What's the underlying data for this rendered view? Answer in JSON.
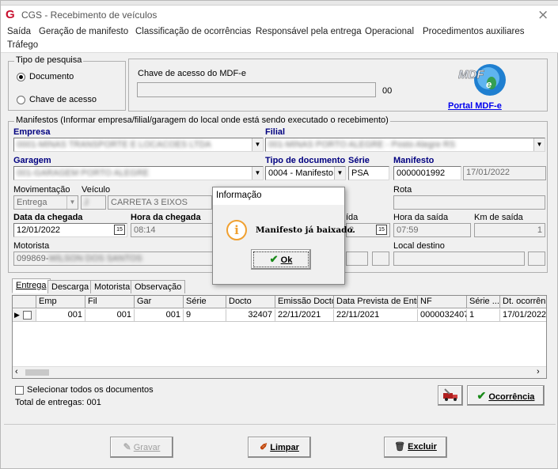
{
  "window": {
    "title": "CGS - Recebimento de veículos",
    "close_glyph": "×"
  },
  "menu": [
    "Saída",
    "Geração de manifesto",
    "Classificação de ocorrências",
    "Responsável pela entrega",
    "Operacional",
    "Procedimentos auxiliares",
    "Tráfego"
  ],
  "tipo_pesquisa": {
    "legend": "Tipo de pesquisa",
    "opt_documento": "Documento",
    "opt_chave": "Chave de acesso",
    "selected": "Documento"
  },
  "chave": {
    "label": "Chave de acesso do MDF-e",
    "value": "",
    "suffix": "00"
  },
  "portal": {
    "link": "Portal MDF-e",
    "logo_text": "MDF-e"
  },
  "manifestos": {
    "legend": "Manifestos (Informar empresa/filial/garagem do local onde está sendo executado o recebimento)",
    "empresa_label": "Empresa",
    "empresa_value": "",
    "filial_label": "Filial",
    "filial_value": "",
    "garagem_label": "Garagem",
    "garagem_value": "",
    "tipo_doc_label": "Tipo de documento",
    "tipo_doc_value": "0004 - Manifesto",
    "serie_label": "Série",
    "serie_value": "PSA",
    "manifesto_label": "Manifesto",
    "manifesto_value": "0000001992",
    "manifesto_date": "17/01/2022",
    "movimentacao_label": "Movimentação",
    "movimentacao_value": "Entrega",
    "veiculo_label": "Veículo",
    "veiculo_value": "CARRETA 3 EIXOS",
    "rota_label": "Rota",
    "data_chegada_label": "Data da chegada",
    "data_chegada_value": "12/01/2022",
    "hora_chegada_label": "Hora da chegada",
    "hora_chegada_value": "08:14",
    "data_saida_label": "ída",
    "data_saida_value": "2",
    "hora_saida_label": "Hora da saída",
    "hora_saida_value": "07:59",
    "km_saida_label": "Km de saída",
    "km_saida_value": "1",
    "motorista_label": "Motorista",
    "motorista_value": "099869-",
    "local_destino_label": "Local destino"
  },
  "tabs": [
    "Entrega",
    "Descarga",
    "Motorista",
    "Observação"
  ],
  "grid": {
    "columns": [
      "Emp",
      "Fil",
      "Gar",
      "Série",
      "Docto",
      "Emissão Docto",
      "Data Prevista de Entrega",
      "NF",
      "Série ...",
      "Dt. ocorrên"
    ],
    "rows": [
      [
        "001",
        "001",
        "001",
        "9",
        "32407",
        "22/11/2021",
        "22/11/2021",
        "0000032407",
        "1",
        "17/01/2022"
      ]
    ]
  },
  "selecionar_todos": "Selecionar todos os documentos",
  "total_entregas": "Total de entregas: 001",
  "buttons": {
    "ocorrencia": "Ocorrência",
    "gravar": "Gravar",
    "limpar": "Limpar",
    "excluir": "Excluir"
  },
  "dialog": {
    "title": "Informação",
    "message": "Manifesto já baixado.",
    "ok": "Ok"
  },
  "colors": {
    "accent_blue": "#000080",
    "link_blue": "#0000ee",
    "info_orange": "#f0a030",
    "ok_green": "#1a8a1a"
  }
}
